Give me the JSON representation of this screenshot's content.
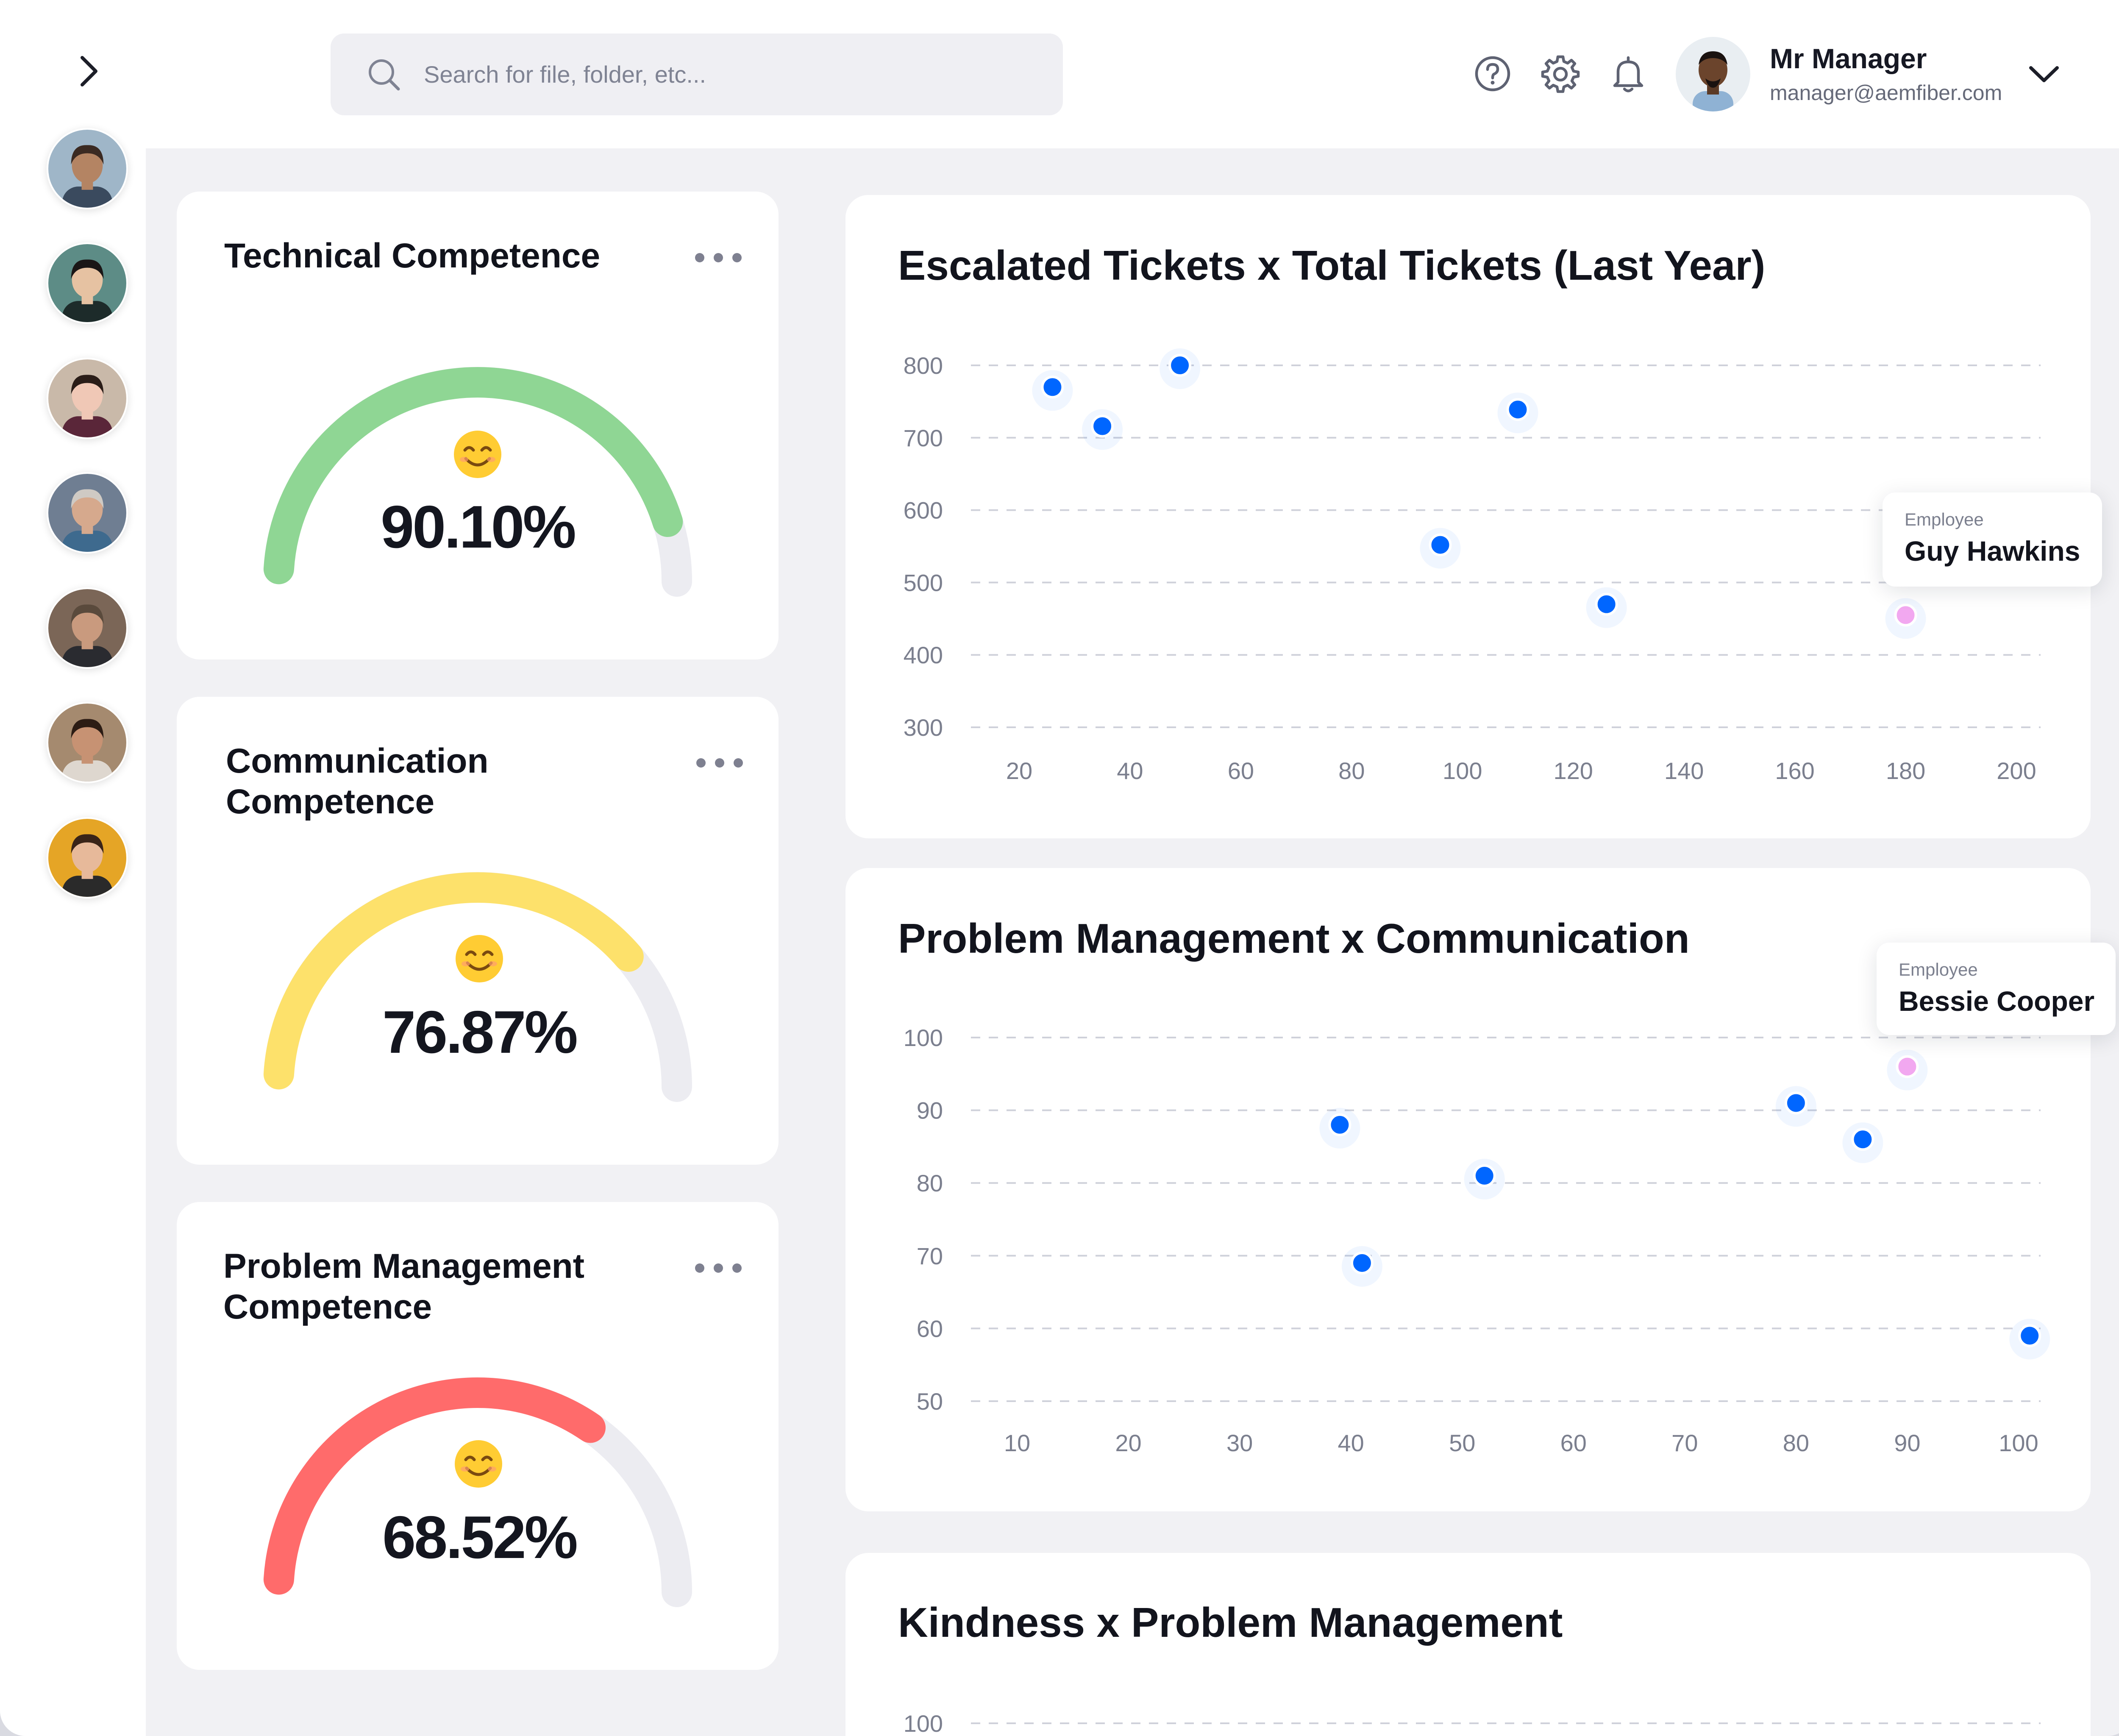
{
  "search": {
    "placeholder": "Search for file, folder, etc..."
  },
  "user": {
    "name": "Mr Manager",
    "email": "manager@aemfiber.com"
  },
  "sidebar": {
    "avatars": [
      {
        "skin": "#b48463",
        "hair": "#3b2a22",
        "bg": "#9fb6c8",
        "shirt": "#3a4a5e"
      },
      {
        "skin": "#e6c2a2",
        "hair": "#1a1616",
        "bg": "#5d8c86",
        "shirt": "#1d2b2a"
      },
      {
        "skin": "#f0c8b6",
        "hair": "#2a1d18",
        "bg": "#c9b9a9",
        "shirt": "#5a2639"
      },
      {
        "skin": "#d6a98d",
        "hair": "#cfcac4",
        "bg": "#6f7e92",
        "shirt": "#3e6a8e"
      },
      {
        "skin": "#c99a7e",
        "hair": "#5a4a3c",
        "bg": "#7b6657",
        "shirt": "#2a2b30"
      },
      {
        "skin": "#c79273",
        "hair": "#2c1c14",
        "bg": "#a58a6f",
        "shirt": "#ded7cf"
      },
      {
        "skin": "#e7b99a",
        "hair": "#3a2418",
        "bg": "#e5a526",
        "shirt": "#2a2a2a"
      }
    ]
  },
  "gauges": [
    {
      "title": "Technical Competence",
      "value": "90.10%",
      "fraction": 0.901,
      "color": "#8fd694",
      "emoji": "😊"
    },
    {
      "title": "Communication Competence",
      "value": "76.87%",
      "fraction": 0.7687,
      "color": "#fde16b",
      "emoji": "😊"
    },
    {
      "title": "Problem Management Competence",
      "value": "68.52%",
      "fraction": 0.6852,
      "color": "#ff6b6b",
      "emoji": "😊"
    }
  ],
  "charts": {
    "escalated": {
      "title": "Escalated Tickets x Total Tickets (Last Year)",
      "tooltip": {
        "label": "Employee",
        "name": "Guy Hawkins"
      }
    },
    "problem_comm": {
      "title": "Problem Management x Communication",
      "tooltip": {
        "label": "Employee",
        "name": "Bessie Cooper"
      }
    },
    "kindness": {
      "title": "Kindness x Problem Management"
    }
  },
  "chart_data": [
    {
      "type": "scatter",
      "title": "Escalated Tickets x Total Tickets (Last Year)",
      "xlim": [
        20,
        200
      ],
      "ylim": [
        300,
        800
      ],
      "x_ticks": [
        20,
        40,
        60,
        80,
        100,
        120,
        140,
        160,
        180,
        200
      ],
      "y_ticks": [
        300,
        400,
        500,
        600,
        700,
        800
      ],
      "grid": true,
      "points": [
        {
          "x": 26,
          "y": 770
        },
        {
          "x": 35,
          "y": 716
        },
        {
          "x": 49,
          "y": 800
        },
        {
          "x": 96,
          "y": 552
        },
        {
          "x": 110,
          "y": 739
        },
        {
          "x": 126,
          "y": 470
        },
        {
          "x": 180,
          "y": 455,
          "highlight": true
        }
      ],
      "colors": {
        "point": "#0066ff",
        "highlight": "#f2a8f0"
      }
    },
    {
      "type": "scatter",
      "title": "Problem Management x Communication",
      "xlim": [
        10,
        100
      ],
      "ylim": [
        50,
        100
      ],
      "x_ticks": [
        10,
        20,
        30,
        40,
        50,
        60,
        70,
        80,
        90,
        100
      ],
      "y_ticks": [
        50,
        60,
        70,
        80,
        90,
        100
      ],
      "grid": true,
      "points": [
        {
          "x": 39,
          "y": 88
        },
        {
          "x": 41,
          "y": 69
        },
        {
          "x": 52,
          "y": 81
        },
        {
          "x": 80,
          "y": 91
        },
        {
          "x": 86,
          "y": 86
        },
        {
          "x": 90,
          "y": 96,
          "highlight": true
        },
        {
          "x": 101,
          "y": 59
        }
      ],
      "colors": {
        "point": "#0066ff",
        "highlight": "#f2a8f0"
      }
    },
    {
      "type": "scatter",
      "title": "Kindness x Problem Management",
      "y_ticks": [
        100
      ],
      "grid": true,
      "points": []
    }
  ]
}
